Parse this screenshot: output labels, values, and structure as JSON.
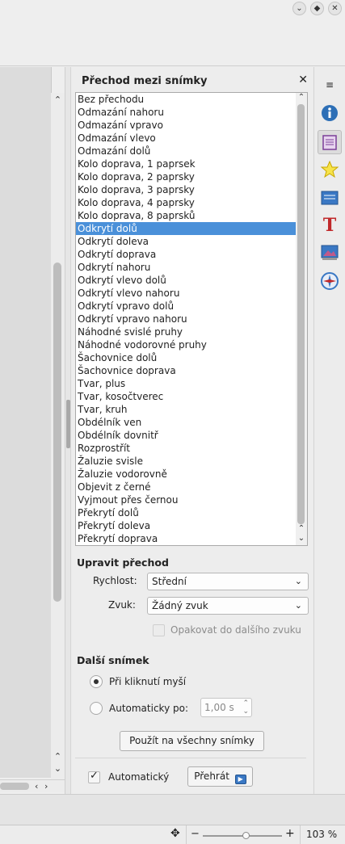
{
  "window": {
    "buttons": [
      "chevron-down",
      "diamond",
      "close"
    ]
  },
  "panel": {
    "title": "Přechod mezi snímky",
    "close_glyph": "✕",
    "transitions": [
      "Bez přechodu",
      "Odmazání nahoru",
      "Odmazání vpravo",
      "Odmazání vlevo",
      "Odmazání dolů",
      "Kolo doprava, 1 paprsek",
      "Kolo doprava, 2 paprsky",
      "Kolo doprava, 3 paprsky",
      "Kolo doprava, 4 paprsky",
      "Kolo doprava, 8 paprsků",
      "Odkrytí dolů",
      "Odkrytí doleva",
      "Odkrytí doprava",
      "Odkrytí nahoru",
      "Odkrytí vlevo dolů",
      "Odkrytí vlevo nahoru",
      "Odkrytí vpravo dolů",
      "Odkrytí vpravo nahoru",
      "Náhodné svislé pruhy",
      "Náhodné vodorovné pruhy",
      "Šachovnice dolů",
      "Šachovnice doprava",
      "Tvar, plus",
      "Tvar, kosočtverec",
      "Tvar, kruh",
      "Obdélník ven",
      "Obdélník dovnitř",
      "Rozprostřít",
      "Žaluzie svisle",
      "Žaluzie vodorovně",
      "Objevit z černé",
      "Vyjmout přes černou",
      "Překrytí dolů",
      "Překrytí doleva",
      "Překrytí doprava"
    ],
    "selected_transition": "Odkrytí dolů",
    "modify": {
      "heading": "Upravit přechod",
      "speed_label": "Rychlost:",
      "speed_value": "Střední",
      "sound_label": "Zvuk:",
      "sound_value": "Žádný zvuk",
      "loop_label": "Opakovat do dalšího zvuku"
    },
    "next_slide": {
      "heading": "Další snímek",
      "on_click_label": "Při kliknutí myší",
      "auto_label": "Automaticky po:",
      "auto_value": "1,00 s",
      "selected": "on_click",
      "apply_all_label": "Použít na všechny snímky"
    },
    "footer": {
      "auto_preview_label": "Automatický",
      "auto_preview_checked": true,
      "play_label": "Přehrát"
    }
  },
  "sidebar_tools": [
    "menu-icon",
    "properties-icon",
    "slide-transition-icon",
    "custom-animation-icon",
    "master-slides-icon",
    "styles-icon",
    "gallery-icon",
    "navigator-icon"
  ],
  "statusbar": {
    "zoom_level": 54,
    "zoom_percent": "103 %",
    "zoom_minus": "−",
    "zoom_plus": "+"
  },
  "colors": {
    "selection": "#4a90d9",
    "accent_purple": "#7b3f98",
    "info_blue": "#2d6fb6"
  }
}
